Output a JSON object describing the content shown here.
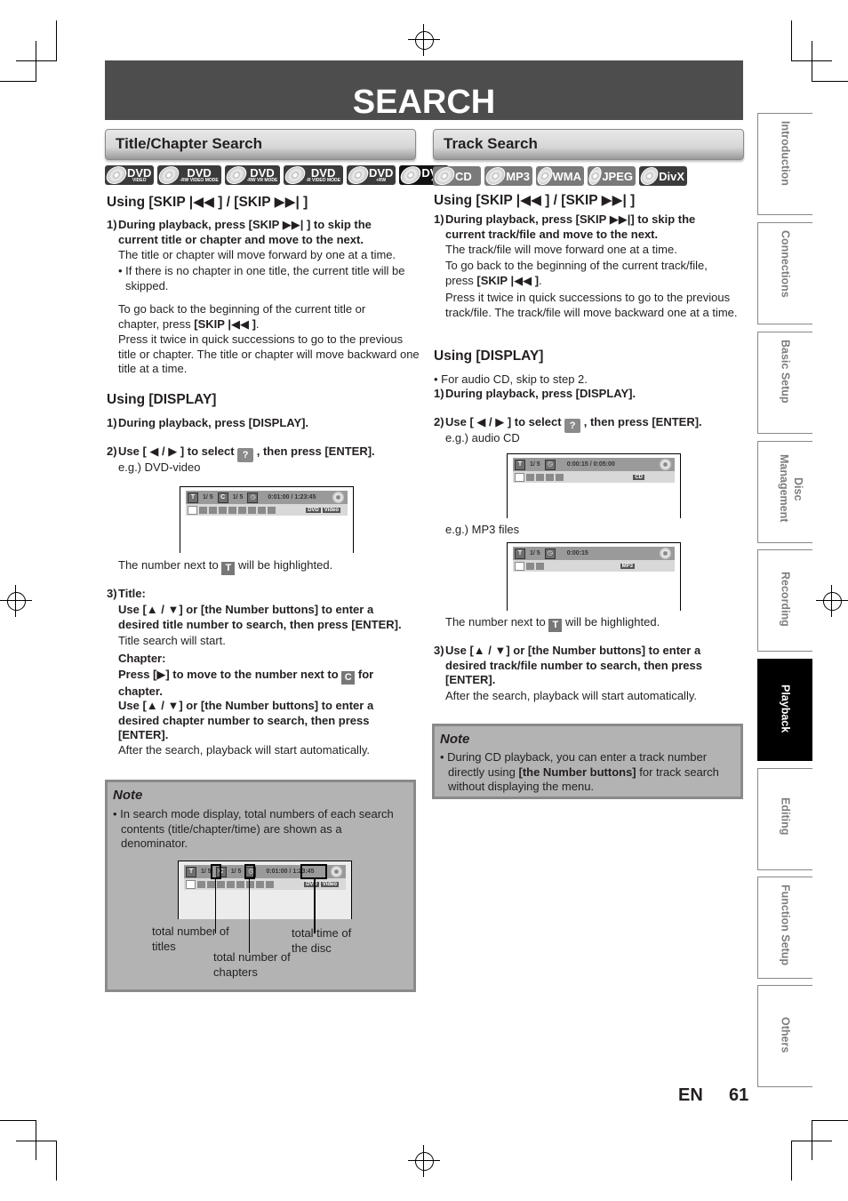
{
  "page": {
    "title": "SEARCH",
    "language": "EN",
    "page_number": "61"
  },
  "side_tabs": [
    {
      "label": "Introduction",
      "active": false
    },
    {
      "label": "Connections",
      "active": false
    },
    {
      "label": "Basic Setup",
      "active": false
    },
    {
      "label": "Disc Management",
      "line1": "Disc",
      "line2": "Management",
      "active": false
    },
    {
      "label": "Recording",
      "active": false
    },
    {
      "label": "Playback",
      "active": true
    },
    {
      "label": "Editing",
      "active": false
    },
    {
      "label": "Function Setup",
      "active": false
    },
    {
      "label": "Others",
      "active": false
    }
  ],
  "left": {
    "section_title": "Title/Chapter Search",
    "badges": [
      {
        "main": "DVD",
        "sub": "VIDEO",
        "style": "dark"
      },
      {
        "main": "DVD",
        "sub": "-RW VIDEO MODE",
        "style": "dark"
      },
      {
        "main": "DVD",
        "sub": "-RW VR MODE",
        "style": "dark"
      },
      {
        "main": "DVD",
        "sub": "-R VIDEO MODE",
        "style": "dark"
      },
      {
        "main": "DVD",
        "sub": "+RW",
        "style": "dark"
      },
      {
        "main": "DVD",
        "sub": "+R",
        "style": "black"
      }
    ],
    "skip_heading": "Using [SKIP |◀◀ ] / [SKIP ▶▶| ]",
    "skip_step1_num": "1)",
    "skip_step1_bold": "During playback, press [SKIP ▶▶| ] to skip the current title or chapter and move to the next.",
    "skip_step1_text": "The title or chapter will move forward by one at a time.",
    "skip_bullet": "• If there is no chapter in one title, the current title will be skipped.",
    "skip_back_text_a": "To go back to the beginning of the current title or chapter, press ",
    "skip_back_bold": "[SKIP |◀◀ ]",
    "skip_back_text_b": ".",
    "skip_twice_text": "Press it twice in quick successions to go to the previous title or chapter. The title or chapter will move backward one title at a time.",
    "display_heading": "Using [DISPLAY]",
    "display_step1_num": "1)",
    "display_step1": "During playback, press [DISPLAY].",
    "display_step2_num": "2)",
    "display_step2_a": "Use [ ◀ / ▶ ] to select ",
    "display_step2_b": " , then press [ENTER].",
    "display_eg": "e.g.) DVD-video",
    "osd": {
      "title_icon": "T",
      "title_pos": "1/  5",
      "chapter_icon": "C",
      "chapter_pos": "1/  5",
      "time": "0:01:00 / 1:23:45",
      "labels": [
        "DVD",
        "Video"
      ]
    },
    "highlight_text_a": "The number next to ",
    "highlight_icon": "T",
    "highlight_text_b": " will be highlighted.",
    "step3_num": "3)",
    "step3_title_label": "Title:",
    "step3_title_bold": "Use [▲ / ▼] or [the Number buttons] to enter a desired title number to search, then press [ENTER].",
    "step3_title_text": "Title search will start.",
    "step3_chapter_label": "Chapter:",
    "step3_chapter_press_a": "Press [▶] to move to the number next to ",
    "step3_chapter_icon": "C",
    "step3_chapter_press_b": " for chapter.",
    "step3_chapter_bold": "Use [▲ / ▼] or [the Number buttons] to enter a desired chapter number to search, then press [ENTER].",
    "step3_after": "After the search, playback will start automatically.",
    "note": {
      "title": "Note",
      "bullet": "• In search mode display, total numbers of each search contents (title/chapter/time) are shown as a denominator.",
      "callouts": [
        "total number of titles",
        "total number of chapters",
        "total time of the disc"
      ]
    }
  },
  "right": {
    "section_title": "Track Search",
    "badges": [
      {
        "main": "CD"
      },
      {
        "main": "MP3"
      },
      {
        "main": "WMA"
      },
      {
        "main": "JPEG"
      },
      {
        "main": "DivX"
      }
    ],
    "skip_heading": "Using [SKIP |◀◀ ] / [SKIP ▶▶| ]",
    "skip_step1_num": "1)",
    "skip_step1_bold": "During playback, press [SKIP ▶▶|] to skip the current track/file and move to the next.",
    "skip_step1_text": "The track/file will move forward one at a time.",
    "skip_back_text_a": "To go back to the beginning of the current track/file, press ",
    "skip_back_bold": "[SKIP |◀◀ ]",
    "skip_back_text_b": ".",
    "skip_twice_text": "Press it twice in quick successions to go to the previous track/file. The track/file will move backward one at a time.",
    "display_heading": "Using [DISPLAY]",
    "display_bullet": "• For audio CD, skip to step 2.",
    "display_step1_num": "1)",
    "display_step1": "During playback, press [DISPLAY].",
    "display_step2_num": "2)",
    "display_step2_a": "Use [ ◀ / ▶ ] to select ",
    "display_step2_b": " , then press [ENTER].",
    "eg_cd": "e.g.) audio CD",
    "osd_cd": {
      "title_icon": "T",
      "track_pos": "1/  5",
      "time": "0:00:15 / 0:05:00",
      "label": "CD"
    },
    "eg_mp3": "e.g.) MP3 files",
    "osd_mp3": {
      "title_icon": "T",
      "track_pos": "1/  5",
      "time": "0:00:15",
      "label": "MP3"
    },
    "highlight_text_a": "The number next to ",
    "highlight_icon": "T",
    "highlight_text_b": " will be highlighted.",
    "step3_num": "3)",
    "step3_bold": "Use [▲ / ▼] or [the Number buttons] to enter a desired track/file number to search, then press [ENTER].",
    "step3_after": "After the search, playback will start automatically.",
    "note": {
      "title": "Note",
      "bullet_a": "• During CD playback, you can enter a track number directly using ",
      "bullet_bold": "[the Number buttons]",
      "bullet_b": " for track search without displaying the menu."
    }
  }
}
